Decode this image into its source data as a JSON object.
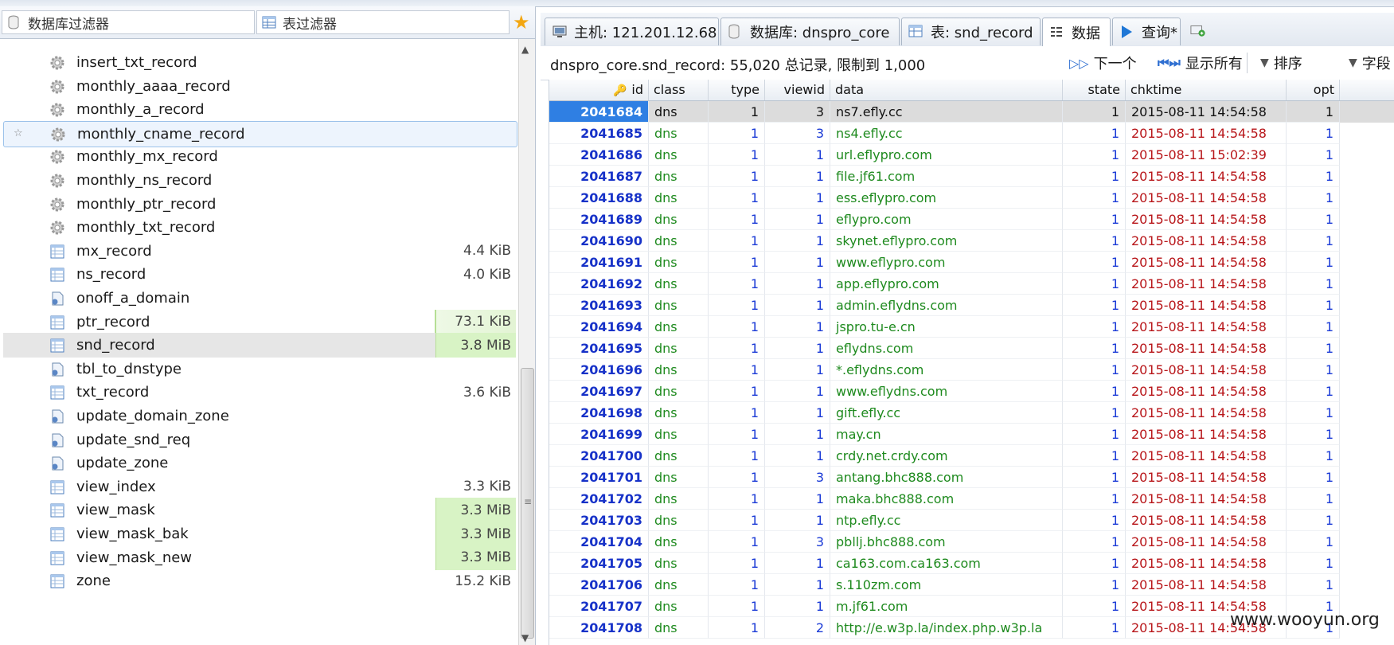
{
  "left_panel": {
    "db_filter_placeholder": "数据库过滤器",
    "table_filter_placeholder": "表过滤器",
    "items": [
      {
        "name": "insert_txt_record",
        "icon": "gear-icon",
        "size": "",
        "state": "normal"
      },
      {
        "name": "monthly_aaaa_record",
        "icon": "gear-icon",
        "size": "",
        "state": "normal"
      },
      {
        "name": "monthly_a_record",
        "icon": "gear-icon",
        "size": "",
        "state": "normal"
      },
      {
        "name": "monthly_cname_record",
        "icon": "gear-icon",
        "size": "",
        "state": "highlight"
      },
      {
        "name": "monthly_mx_record",
        "icon": "gear-icon",
        "size": "",
        "state": "normal"
      },
      {
        "name": "monthly_ns_record",
        "icon": "gear-icon",
        "size": "",
        "state": "normal"
      },
      {
        "name": "monthly_ptr_record",
        "icon": "gear-icon",
        "size": "",
        "state": "normal"
      },
      {
        "name": "monthly_txt_record",
        "icon": "gear-icon",
        "size": "",
        "state": "normal"
      },
      {
        "name": "mx_record",
        "icon": "table-icon",
        "size": "4.4 KiB",
        "state": "normal"
      },
      {
        "name": "ns_record",
        "icon": "table-icon",
        "size": "4.0 KiB",
        "state": "normal"
      },
      {
        "name": "onoff_a_domain",
        "icon": "procedure-icon",
        "size": "",
        "state": "normal"
      },
      {
        "name": "ptr_record",
        "icon": "table-icon",
        "size": "73.1 KiB",
        "state": "faintbar"
      },
      {
        "name": "snd_record",
        "icon": "table-icon",
        "size": "3.8 MiB",
        "state": "selected"
      },
      {
        "name": "tbl_to_dnstype",
        "icon": "procedure-icon",
        "size": "",
        "state": "normal"
      },
      {
        "name": "txt_record",
        "icon": "table-icon",
        "size": "3.6 KiB",
        "state": "normal"
      },
      {
        "name": "update_domain_zone",
        "icon": "procedure-icon",
        "size": "",
        "state": "normal"
      },
      {
        "name": "update_snd_req",
        "icon": "procedure-icon",
        "size": "",
        "state": "normal"
      },
      {
        "name": "update_zone",
        "icon": "procedure-icon",
        "size": "",
        "state": "normal"
      },
      {
        "name": "view_index",
        "icon": "table-icon",
        "size": "3.3 KiB",
        "state": "normal"
      },
      {
        "name": "view_mask",
        "icon": "table-icon",
        "size": "3.3 MiB",
        "state": "greenbar"
      },
      {
        "name": "view_mask_bak",
        "icon": "table-icon",
        "size": "3.3 MiB",
        "state": "greenbar"
      },
      {
        "name": "view_mask_new",
        "icon": "table-icon",
        "size": "3.3 MiB",
        "state": "greenbar"
      },
      {
        "name": "zone",
        "icon": "table-icon",
        "size": "15.2 KiB",
        "state": "normal"
      }
    ]
  },
  "tabs": {
    "host": "主机: 121.201.12.68",
    "database": "数据库: dnspro_core",
    "table": "表: snd_record",
    "data": "数据",
    "query": "查询*"
  },
  "infobar": {
    "summary": "dnspro_core.snd_record: 55,020 总记录, 限制到 1,000",
    "next_label": "下一个",
    "show_all_label": "显示所有",
    "sort_label": "排序",
    "fields_label": "字段"
  },
  "grid": {
    "columns": [
      "id",
      "class",
      "type",
      "viewid",
      "data",
      "state",
      "chktime",
      "opt"
    ],
    "rows": [
      [
        "2041684",
        "dns",
        "1",
        "3",
        "ns7.efly.cc",
        "1",
        "2015-08-11 14:54:58",
        "1"
      ],
      [
        "2041685",
        "dns",
        "1",
        "3",
        "ns4.efly.cc",
        "1",
        "2015-08-11 14:54:58",
        "1"
      ],
      [
        "2041686",
        "dns",
        "1",
        "1",
        "url.eflypro.com",
        "1",
        "2015-08-11 15:02:39",
        "1"
      ],
      [
        "2041687",
        "dns",
        "1",
        "1",
        "file.jf61.com",
        "1",
        "2015-08-11 14:54:58",
        "1"
      ],
      [
        "2041688",
        "dns",
        "1",
        "1",
        "ess.eflypro.com",
        "1",
        "2015-08-11 14:54:58",
        "1"
      ],
      [
        "2041689",
        "dns",
        "1",
        "1",
        "eflypro.com",
        "1",
        "2015-08-11 14:54:58",
        "1"
      ],
      [
        "2041690",
        "dns",
        "1",
        "1",
        "skynet.eflypro.com",
        "1",
        "2015-08-11 14:54:58",
        "1"
      ],
      [
        "2041691",
        "dns",
        "1",
        "1",
        "www.eflypro.com",
        "1",
        "2015-08-11 14:54:58",
        "1"
      ],
      [
        "2041692",
        "dns",
        "1",
        "1",
        "app.eflypro.com",
        "1",
        "2015-08-11 14:54:58",
        "1"
      ],
      [
        "2041693",
        "dns",
        "1",
        "1",
        "admin.eflydns.com",
        "1",
        "2015-08-11 14:54:58",
        "1"
      ],
      [
        "2041694",
        "dns",
        "1",
        "1",
        "jspro.tu-e.cn",
        "1",
        "2015-08-11 14:54:58",
        "1"
      ],
      [
        "2041695",
        "dns",
        "1",
        "1",
        "eflydns.com",
        "1",
        "2015-08-11 14:54:58",
        "1"
      ],
      [
        "2041696",
        "dns",
        "1",
        "1",
        "*.eflydns.com",
        "1",
        "2015-08-11 14:54:58",
        "1"
      ],
      [
        "2041697",
        "dns",
        "1",
        "1",
        "www.eflydns.com",
        "1",
        "2015-08-11 14:54:58",
        "1"
      ],
      [
        "2041698",
        "dns",
        "1",
        "1",
        "gift.efly.cc",
        "1",
        "2015-08-11 14:54:58",
        "1"
      ],
      [
        "2041699",
        "dns",
        "1",
        "1",
        "may.cn",
        "1",
        "2015-08-11 14:54:58",
        "1"
      ],
      [
        "2041700",
        "dns",
        "1",
        "1",
        "crdy.net.crdy.com",
        "1",
        "2015-08-11 14:54:58",
        "1"
      ],
      [
        "2041701",
        "dns",
        "1",
        "3",
        "antang.bhc888.com",
        "1",
        "2015-08-11 14:54:58",
        "1"
      ],
      [
        "2041702",
        "dns",
        "1",
        "1",
        "maka.bhc888.com",
        "1",
        "2015-08-11 14:54:58",
        "1"
      ],
      [
        "2041703",
        "dns",
        "1",
        "1",
        "ntp.efly.cc",
        "1",
        "2015-08-11 14:54:58",
        "1"
      ],
      [
        "2041704",
        "dns",
        "1",
        "3",
        "pbllj.bhc888.com",
        "1",
        "2015-08-11 14:54:58",
        "1"
      ],
      [
        "2041705",
        "dns",
        "1",
        "1",
        "ca163.com.ca163.com",
        "1",
        "2015-08-11 14:54:58",
        "1"
      ],
      [
        "2041706",
        "dns",
        "1",
        "1",
        "s.110zm.com",
        "1",
        "2015-08-11 14:54:58",
        "1"
      ],
      [
        "2041707",
        "dns",
        "1",
        "1",
        "m.jf61.com",
        "1",
        "2015-08-11 14:54:58",
        "1"
      ],
      [
        "2041708",
        "dns",
        "1",
        "2",
        "http://e.w3p.la/index.php.w3p.la",
        "1",
        "2015-08-11 14:54:58",
        "1"
      ]
    ]
  },
  "watermark": "www.wooyun.org",
  "colors": {
    "id": "#1732c8",
    "text_green": "#1e8a1e",
    "number_blue": "#1a3ad6",
    "time_red": "#b8161a",
    "selection": "#2f7fe3"
  }
}
